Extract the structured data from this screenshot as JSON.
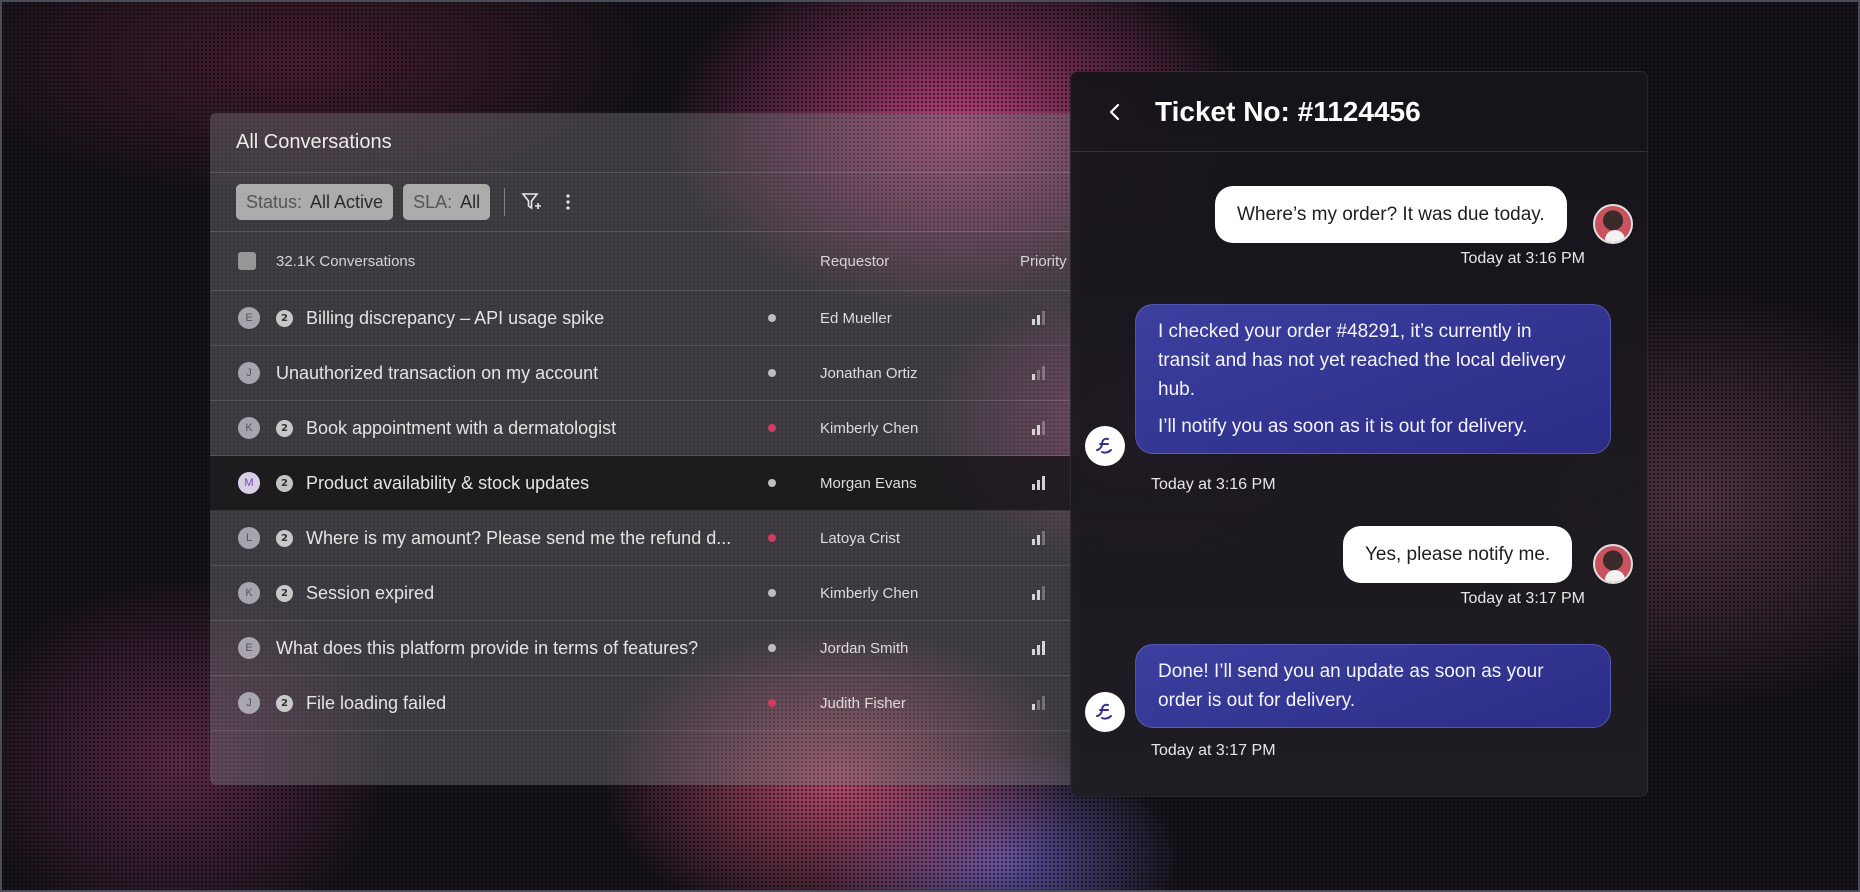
{
  "list": {
    "title": "All Conversations",
    "filters": [
      {
        "key": "Status:",
        "value": "All Active"
      },
      {
        "key": "SLA:",
        "value": "All"
      }
    ],
    "header": {
      "count": "32.1K Conversations",
      "requestor": "Requestor",
      "priority": "Priority"
    },
    "rows": [
      {
        "initial": "E",
        "count": "2",
        "subject": "Billing discrepancy – API usage spike",
        "status_color": "#bdbdbd",
        "requestor": "Ed Mueller",
        "priority_level": 2
      },
      {
        "initial": "J",
        "count": "",
        "subject": "Unauthorized transaction on my account",
        "status_color": "#bdbdbd",
        "requestor": "Jonathan Ortiz",
        "priority_level": 1
      },
      {
        "initial": "K",
        "count": "2",
        "subject": "Book appointment with a dermatologist",
        "status_color": "#d23a5e",
        "requestor": "Kimberly Chen",
        "priority_level": 2
      },
      {
        "initial": "M",
        "count": "2",
        "subject": "Product availability & stock updates",
        "status_color": "#bdbdbd",
        "requestor": "Morgan Evans",
        "priority_level": 3
      },
      {
        "initial": "L",
        "count": "2",
        "subject": "Where is my amount? Please send me the refund d...",
        "status_color": "#d23a5e",
        "requestor": "Latoya Crist",
        "priority_level": 2
      },
      {
        "initial": "K",
        "count": "2",
        "subject": "Session expired",
        "status_color": "#bdbdbd",
        "requestor": "Kimberly Chen",
        "priority_level": 2
      },
      {
        "initial": "E",
        "count": "",
        "subject": "What does this platform provide in terms of features?",
        "status_color": "#bdbdbd",
        "requestor": "Jordan Smith",
        "priority_level": 3
      },
      {
        "initial": "J",
        "count": "2",
        "subject": "File loading failed",
        "status_color": "#d23a5e",
        "requestor": "Judith Fisher",
        "priority_level": 1
      }
    ]
  },
  "ticket": {
    "title": "Ticket No: #1124456",
    "messages": [
      {
        "from": "user",
        "paragraphs": [
          "Where’s my order? It was due today."
        ],
        "time": "Today at 3:16 PM"
      },
      {
        "from": "bot",
        "paragraphs": [
          "I checked your order #48291, it’s currently in transit and has not yet reached the local delivery hub.",
          "I’ll notify you as soon as it is out for delivery."
        ],
        "time": "Today at 3:16 PM"
      },
      {
        "from": "user",
        "paragraphs": [
          "Yes, please notify me."
        ],
        "time": "Today at 3:17 PM"
      },
      {
        "from": "bot",
        "paragraphs": [
          "Done! I’ll send you an update as soon as your order is out for delivery."
        ],
        "time": "Today at 3:17 PM"
      }
    ]
  },
  "colors": {
    "bot_bubble": "#2f3190",
    "user_bubble": "#ffffff",
    "status_urgent": "#d23a5e"
  }
}
